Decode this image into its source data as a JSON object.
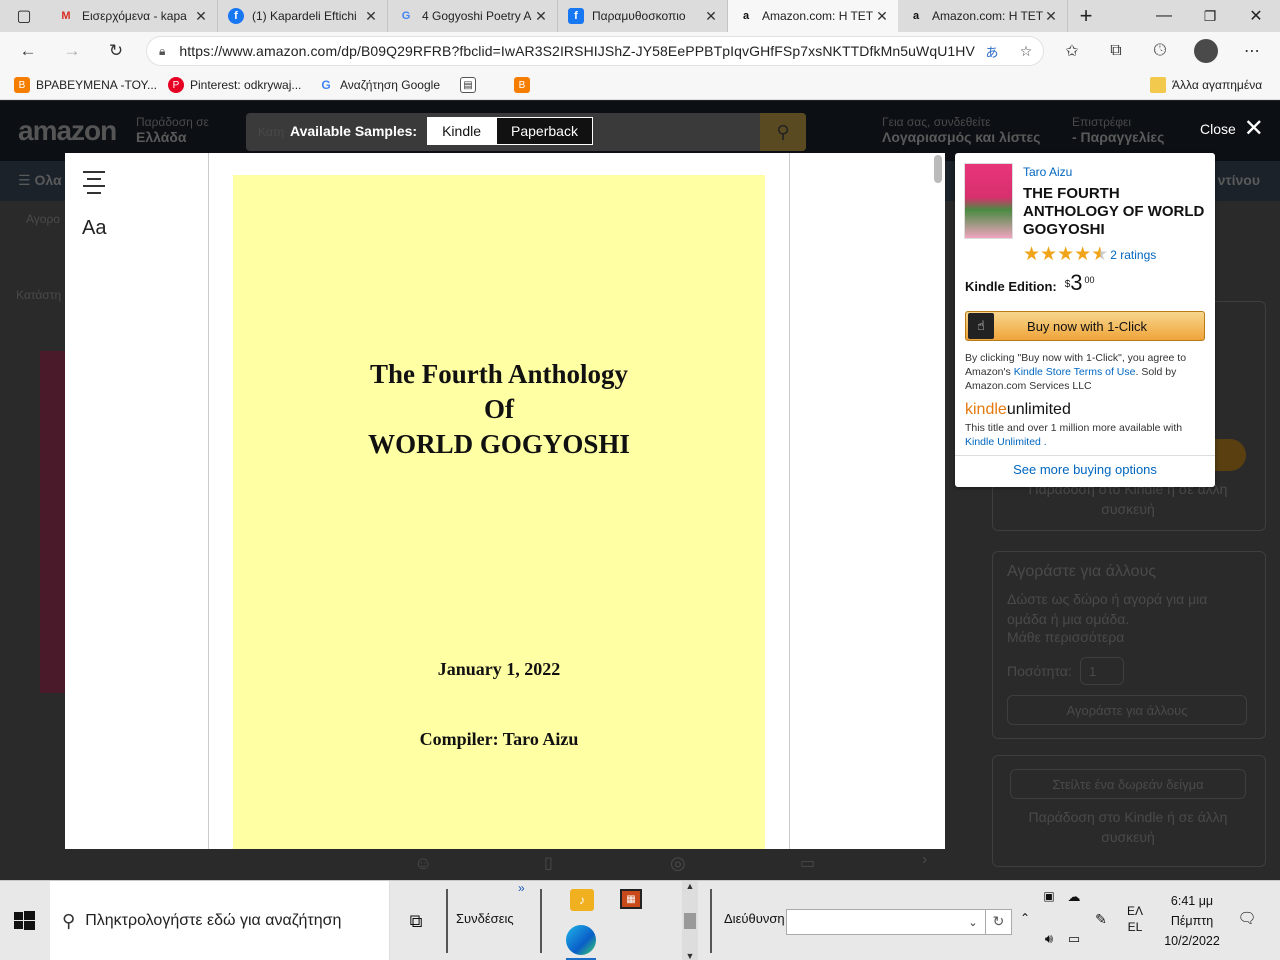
{
  "browser": {
    "tabs": [
      {
        "label": "Εισερχόμενα - kapa",
        "icon": "gmail-icon",
        "active": false
      },
      {
        "label": "(1) Kapardeli Eftichi",
        "icon": "facebook-icon",
        "active": false
      },
      {
        "label": "4 Gogyoshi Poetry A",
        "icon": "google-icon",
        "active": false
      },
      {
        "label": "Παραμυθοσκοπιο",
        "icon": "facebook-icon",
        "active": false
      },
      {
        "label": "Amazon.com: Η ΤΕΤ",
        "icon": "amazon-icon",
        "active": true
      },
      {
        "label": "Amazon.com: Η ΤΕΤ",
        "icon": "amazon-icon",
        "active": false
      }
    ],
    "url": "https://www.amazon.com/dp/B09Q29RFRB?fbclid=IwAR3S2IRSHIJShZ-JY58EePPBTpIqvGHfFSp7xsNKTTDfkMn5uWqU1HVLV...",
    "bookmarks": [
      {
        "label": "ΒΡΑΒΕΥΜΕΝΑ -ΤΟΥ...",
        "icon": "blogger-icon"
      },
      {
        "label": "Pinterest: odkrywaj...",
        "icon": "pinterest-icon"
      },
      {
        "label": "Αναζήτηση Google",
        "icon": "google-icon"
      },
      {
        "label": "",
        "icon": "calendar-icon"
      },
      {
        "label": "",
        "icon": "blogger-icon"
      }
    ],
    "other_favorites": "Άλλα αγαπημένα"
  },
  "amazon_bg": {
    "logo": "amazon",
    "deliver_to": "Παράδοση σε",
    "deliver_country": "Ελλάδα",
    "search_placeholder": "Κατη",
    "greeting": "Γεια σας, συνδεθείτε",
    "account": "Λογαριασμός και λίστες",
    "returns": "Επιστρέφει",
    "orders": "- Παραγγελίες",
    "menu": "Ολα",
    "nav_right": "ντίνου",
    "breadcrumb": "Αγορο",
    "category": "Κατάστη",
    "delivery_kindle": "Παράδοση στο Kindle ή σε άλλη συσκευή",
    "buy_for_others": "Αγοράστε για άλλους",
    "gift_text": "Δώστε ως δώρο ή αγορά για μια ομάδα ή μια ομάδα.",
    "learn_more": "Μάθε περισσότερα",
    "quantity_label": "Ποσότητα:",
    "quantity_value": "1",
    "buy_for_others_btn": "Αγοράστε για άλλους",
    "send_sample": "Στείλτε ένα δωρεάν δείγμα",
    "delivery_kindle2": "Παράδοση στο Kindle ή σε άλλη συσκευή"
  },
  "reader": {
    "samples_label": "Available Samples:",
    "formats": [
      "Kindle",
      "Paperback"
    ],
    "selected_format": "Kindle",
    "close": "Close",
    "font_button": "Aa",
    "cover": {
      "title_line1": "The Fourth Anthology",
      "title_line2": "Of",
      "title_line3": "WORLD GOGYOSHI",
      "date": "January 1, 2022",
      "compiler": "Compiler: Taro Aizu",
      "color": "#ffffa4"
    }
  },
  "buybox": {
    "author": "Taro Aizu",
    "title": "THE FOURTH ANTHOLOGY OF WORLD GOGYOSHI",
    "stars": 4.5,
    "ratings": "2 ratings",
    "edition_label": "Kindle Edition:",
    "price_currency": "$",
    "price_whole": "3",
    "price_fraction": "00",
    "buy_button": "Buy now with 1-Click",
    "terms_prefix": "By clicking \"Buy now with 1-Click\", you agree to Amazon's",
    "terms_link": "Kindle Store Terms of Use",
    "terms_suffix": ". Sold by Amazon.com Services LLC",
    "ku_brand_1": "kindle",
    "ku_brand_2": "unlimited",
    "ku_text": "This title and over 1 million more available with",
    "ku_link": "Kindle Unlimited",
    "ku_dot": ".",
    "more_options": "See more buying options",
    "accent": "#0066c0",
    "button_color": "#f0a43a"
  },
  "taskbar": {
    "search_placeholder": "Πληκτρολογήστε εδώ για αναζήτηση",
    "links_toolbar": "Συνδέσεις",
    "links_overflow": "»",
    "address_label": "Διεύθυνση",
    "address_value": "",
    "lang_top": "ΕΛ",
    "lang_bottom": "EL",
    "time": "6:41 μμ",
    "day": "Πέμπτη",
    "date": "10/2/2022"
  }
}
